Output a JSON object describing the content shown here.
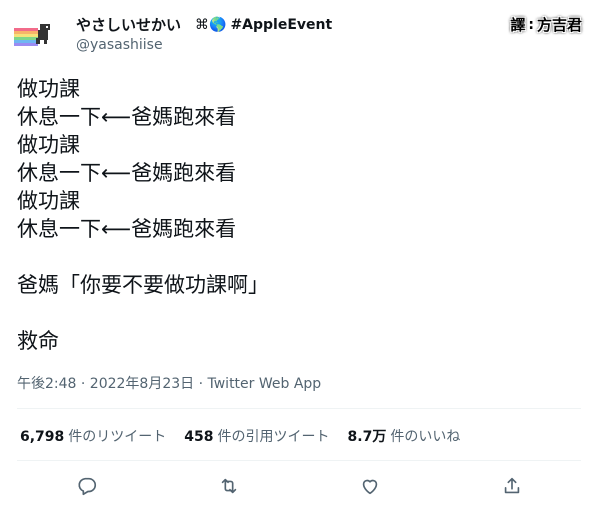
{
  "author": {
    "display_name": "やさしいせかい",
    "name_emoji": "⌘🌎",
    "name_hashtag": "#AppleEvent",
    "handle": "@yasashiise",
    "avatar_icon": "rainbow-dino-avatar"
  },
  "translation_badge": {
    "char1": "譯",
    "colon": ":",
    "chars": "方吉君"
  },
  "tweet": {
    "lines": [
      "做功課",
      "休息一下⟵爸媽跑來看",
      "做功課",
      "休息一下⟵爸媽跑來看",
      "做功課",
      "休息一下⟵爸媽跑來看",
      "",
      "爸媽「你要不要做功課啊」",
      "",
      "救命"
    ],
    "timestamp": "午後2:48 · 2022年8月23日 · Twitter Web App"
  },
  "stats": {
    "retweets_count": "6,798",
    "retweets_label": "件のリツイート",
    "quotes_count": "458",
    "quotes_label": "件の引用ツイート",
    "likes_count": "8.7万",
    "likes_label": "件のいいね"
  },
  "actions": [
    {
      "name": "reply",
      "icon": "reply-icon"
    },
    {
      "name": "retweet",
      "icon": "retweet-icon"
    },
    {
      "name": "like",
      "icon": "heart-icon"
    },
    {
      "name": "share",
      "icon": "share-icon"
    }
  ],
  "colors": {
    "text": "#0f1419",
    "secondary": "#536471",
    "divider": "#eff3f4"
  }
}
